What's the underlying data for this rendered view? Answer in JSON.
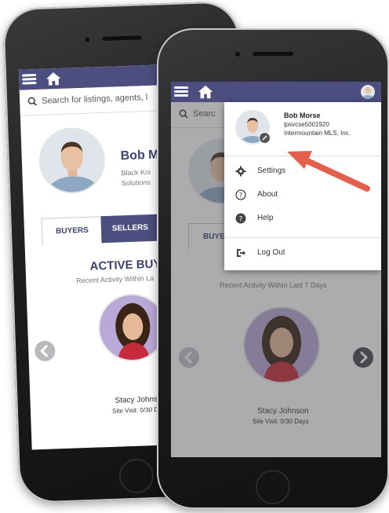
{
  "back_phone": {
    "search_placeholder": "Search for listings, agents, l",
    "agent_name": "Bob M",
    "agent_company_1": "Black Kni",
    "agent_company_2": "Solutions",
    "tabs": [
      {
        "label": "BUYERS"
      },
      {
        "label": "SELLERS"
      }
    ],
    "section_title": "ACTIVE BUYE",
    "section_subtitle": "Recent Activity Within La",
    "client_name": "Stacy Johnso",
    "client_detail": "Site Visit: 0/30 D"
  },
  "front_phone": {
    "search_placeholder": "Searc",
    "tab_partial": "BUYE",
    "section_subtitle": "Recent Activity Within Last 7 Days",
    "client_name": "Stacy Johnson",
    "client_detail": "Site Visit: 0/30 Days",
    "dropdown": {
      "user_name": "Bob Morse",
      "user_id": "lpsvcse5001920",
      "user_org": "Intermountain MLS, Inc.",
      "items": [
        {
          "label": "Settings",
          "icon": "gear-icon"
        },
        {
          "label": "About",
          "icon": "question-circle-icon"
        },
        {
          "label": "Help",
          "icon": "help-circle-icon"
        },
        {
          "label": "Log Out",
          "icon": "logout-icon"
        }
      ]
    }
  },
  "colors": {
    "navbar": "#4b4e7e",
    "accent": "#3e4270",
    "arrow": "#e2604c"
  }
}
